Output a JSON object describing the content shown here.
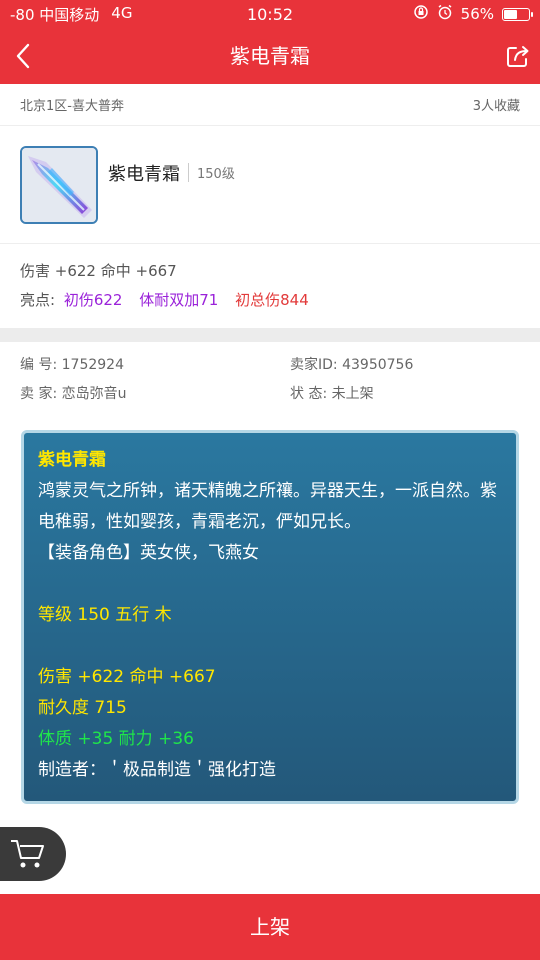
{
  "status": {
    "carrier": "-80 中国移动",
    "network": "4G",
    "time": "10:52",
    "battery": "56%",
    "battery_level": 0.56
  },
  "nav": {
    "title": "紫电青霜"
  },
  "listing": {
    "server": "北京1区-喜大普奔",
    "favorites": "3人收藏",
    "item_name": "紫电青霜",
    "item_level": "150级",
    "stats_line": "伤害 +622 命中 +667",
    "highlights_label": "亮点:",
    "highlights": [
      "初伤622",
      "体耐双加71",
      "初总伤844"
    ]
  },
  "info": {
    "id_label": "编  号:",
    "id_value": "1752924",
    "seller_id_label": "卖家ID:",
    "seller_id_value": "43950756",
    "seller_label": "卖  家:",
    "seller_value": "恋岛弥音u",
    "state_label": "状  态:",
    "state_value": "未上架"
  },
  "description": {
    "name": "紫电青霜",
    "lore": "鸿蒙灵气之所钟，诸天精魄之所禳。异器天生，一派自然。紫电稚弱，性如婴孩，青霜老沉，俨如兄长。",
    "role": "【装备角色】英女侠，飞燕女",
    "level_line": "等级 150  五行 木",
    "attack_line": "伤害 +622 命中 +667",
    "durability_line": "耐久度 715",
    "bonus_line": "体质 +35 耐力 +36",
    "maker_line": "制造者：＇极品制造＇强化打造"
  },
  "bottom": {
    "action": "上架"
  }
}
